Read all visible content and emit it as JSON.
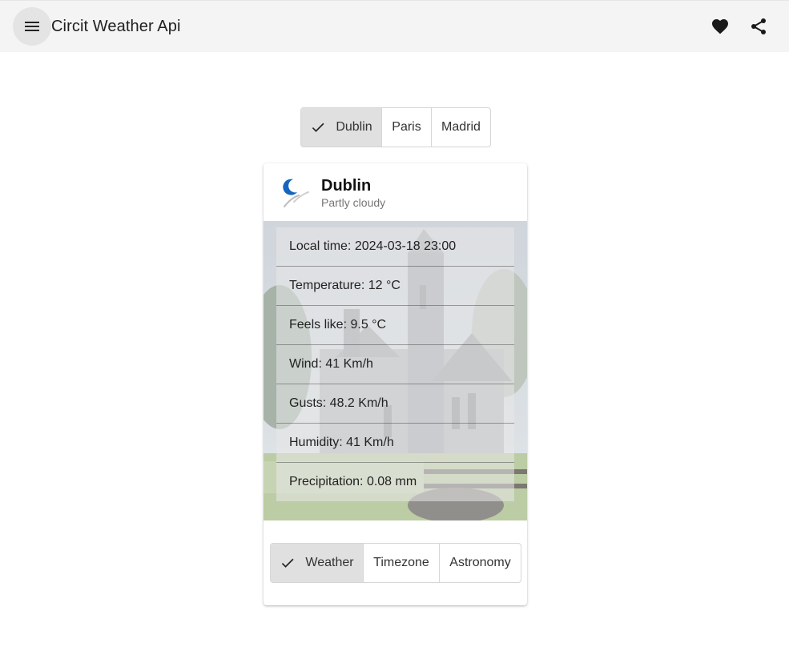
{
  "app": {
    "title": "Circit Weather Api",
    "menu_icon": "menu-icon",
    "favorite_icon": "heart-icon",
    "share_icon": "share-icon"
  },
  "cities": [
    {
      "label": "Dublin",
      "selected": true
    },
    {
      "label": "Paris",
      "selected": false
    },
    {
      "label": "Madrid",
      "selected": false
    }
  ],
  "card": {
    "city": "Dublin",
    "condition": "Partly cloudy",
    "weather_icon": "partly-cloudy-night-icon",
    "details": [
      "Local time: 2024-03-18 23:00",
      "Temperature: 12 °C",
      "Feels like: 9.5 °C",
      "Wind: 41 Km/h",
      "Gusts: 48.2 Km/h",
      "Humidity: 41 Km/h",
      "Precipitation: 0.08 mm"
    ],
    "tabs": [
      {
        "label": "Weather",
        "selected": true
      },
      {
        "label": "Timezone",
        "selected": false
      },
      {
        "label": "Astronomy",
        "selected": false
      }
    ]
  },
  "colors": {
    "toolbar_bg": "#f4f4f4",
    "selected_toggle_bg": "#e0e0e0",
    "moon_icon": "#1565c0"
  }
}
